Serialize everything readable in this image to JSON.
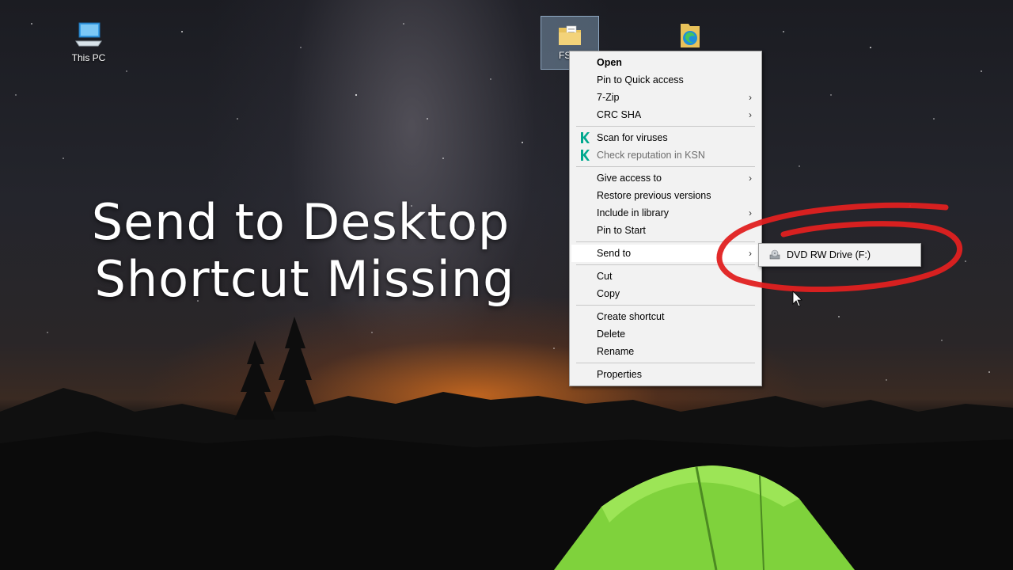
{
  "desktop": {
    "icons": [
      {
        "label": "This PC",
        "icon": "computer-icon"
      },
      {
        "label": "FS",
        "icon": "folder-icon"
      },
      {
        "label": "",
        "icon": "edge-folder-icon"
      }
    ]
  },
  "headline": {
    "line1": "Send to Desktop",
    "line2": "Shortcut Missing"
  },
  "context_menu": {
    "items": [
      {
        "label": "Open"
      },
      {
        "label": "Pin to Quick access"
      },
      {
        "label": "7-Zip"
      },
      {
        "label": "CRC SHA"
      },
      {
        "label": "Scan for viruses",
        "icon": "kaspersky-icon"
      },
      {
        "label": "Check reputation in KSN",
        "icon": "kaspersky-icon"
      },
      {
        "label": "Give access to"
      },
      {
        "label": "Restore previous versions"
      },
      {
        "label": "Include in library"
      },
      {
        "label": "Pin to Start"
      },
      {
        "label": "Send to"
      },
      {
        "label": "Cut"
      },
      {
        "label": "Copy"
      },
      {
        "label": "Create shortcut"
      },
      {
        "label": "Delete"
      },
      {
        "label": "Rename"
      },
      {
        "label": "Properties"
      }
    ],
    "submenu_arrow": "›"
  },
  "send_to_submenu": {
    "items": [
      {
        "label": "DVD RW Drive (F:)",
        "icon": "dvd-drive-icon"
      }
    ]
  },
  "colors": {
    "annotation_circle": "#e02020",
    "kaspersky_green": "#00a88e",
    "tent_green": "#8ee04a"
  }
}
